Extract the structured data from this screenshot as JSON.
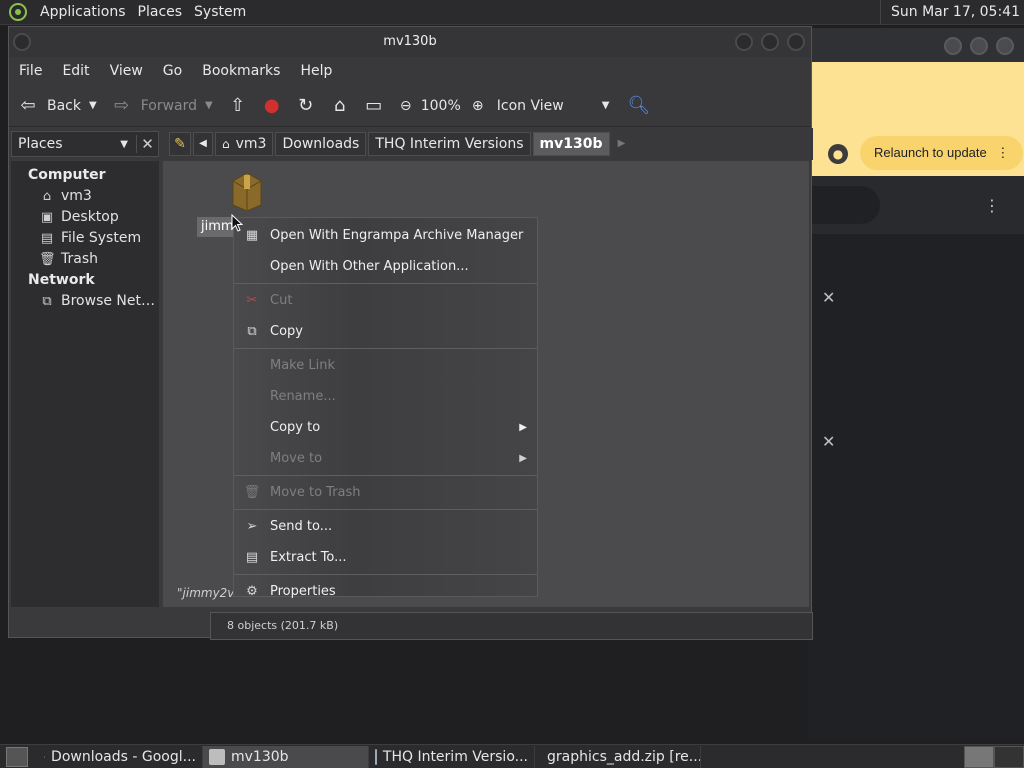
{
  "top_panel": {
    "menus": [
      "Applications",
      "Places",
      "System"
    ],
    "clock": "Sun Mar 17, 05:41"
  },
  "chrome": {
    "relaunch_label": "Relaunch to update",
    "kebab": "⋮",
    "close": "✕"
  },
  "caja": {
    "title": "mv130b",
    "menus": [
      "File",
      "Edit",
      "View",
      "Go",
      "Bookmarks",
      "Help"
    ],
    "toolbar": {
      "back": "Back",
      "forward": "Forward",
      "zoom": "100%",
      "view_mode": "Icon View"
    },
    "places_header": "Places",
    "breadcrumbs": [
      "vm3",
      "Downloads",
      "THQ Interim Versions",
      "mv130b"
    ],
    "sidebar": {
      "computer_label": "Computer",
      "computer_items": [
        {
          "label": "vm3",
          "icon": "home-icon"
        },
        {
          "label": "Desktop",
          "icon": "desktop-icon"
        },
        {
          "label": "File System",
          "icon": "drive-icon"
        },
        {
          "label": "Trash",
          "icon": "trash-icon"
        }
      ],
      "network_label": "Network",
      "network_items": [
        {
          "label": "Browse Net…",
          "icon": "network-icon"
        }
      ]
    },
    "selected_file_label": "jimmy",
    "status_text": "\"jimmy2v13",
    "status_count": "8 objects (201.7 kB)"
  },
  "context_menu": {
    "items": [
      {
        "label": "Open With Engrampa Archive Manager",
        "enabled": true,
        "icon": "archive-icon"
      },
      {
        "label": "Open With Other Application...",
        "enabled": true,
        "icon": ""
      },
      {
        "label": "Cut",
        "enabled": false,
        "icon": "scissors-icon"
      },
      {
        "label": "Copy",
        "enabled": true,
        "icon": "copy-icon"
      },
      {
        "label": "Make Link",
        "enabled": false,
        "icon": ""
      },
      {
        "label": "Rename...",
        "enabled": false,
        "icon": ""
      },
      {
        "label": "Copy to",
        "enabled": true,
        "icon": "",
        "submenu": true
      },
      {
        "label": "Move to",
        "enabled": false,
        "icon": "",
        "submenu": true
      },
      {
        "label": "Move to Trash",
        "enabled": false,
        "icon": "trash-icon"
      },
      {
        "label": "Send to...",
        "enabled": true,
        "icon": "send-icon"
      },
      {
        "label": "Extract To...",
        "enabled": true,
        "icon": "extract-icon"
      },
      {
        "label": "Properties",
        "enabled": true,
        "icon": "properties-icon"
      }
    ]
  },
  "taskbar": {
    "tasks": [
      {
        "label": "Downloads - Googl...",
        "icon": "chrome-icon",
        "active": false
      },
      {
        "label": "mv130b",
        "icon": "folder-icon",
        "active": true
      },
      {
        "label": "THQ Interim Versio...",
        "icon": "folder-icon",
        "active": false
      },
      {
        "label": "graphics_add.zip [re...",
        "icon": "archive-icon",
        "active": false
      }
    ]
  },
  "colors": {
    "accent_yellow": "#fde293",
    "panel": "#2b2b2d",
    "window_bg": "#3a3a3c"
  }
}
